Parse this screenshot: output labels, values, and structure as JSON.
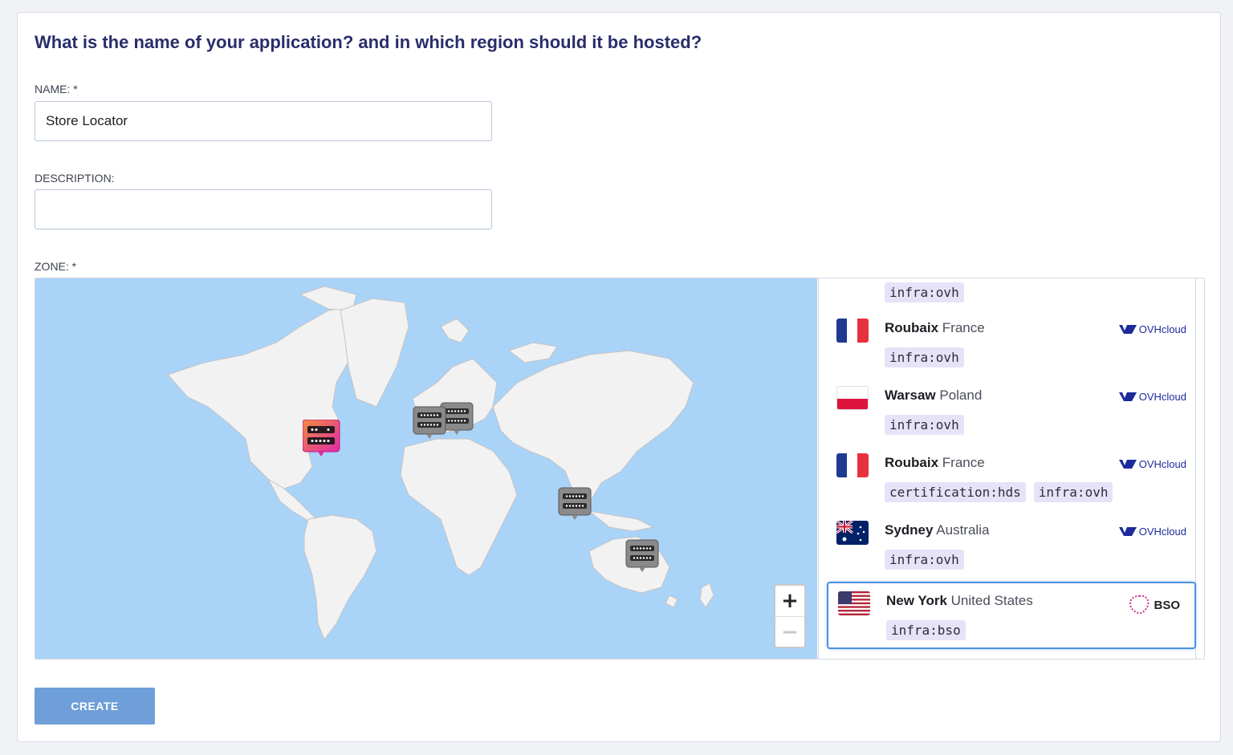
{
  "form": {
    "title": "What is the name of your application? and in which region should it be hosted?",
    "name_label": "NAME: *",
    "name_value": "Store Locator",
    "description_label": "DESCRIPTION:",
    "description_value": "",
    "zone_label": "ZONE: *",
    "create_label": "CREATE"
  },
  "map": {
    "zoom_in": "+",
    "zoom_out": "−",
    "markers": [
      {
        "name": "New York",
        "selected": true
      },
      {
        "name": "Roubaix",
        "selected": false
      },
      {
        "name": "Warsaw",
        "selected": false
      },
      {
        "name": "Singapore",
        "selected": false
      },
      {
        "name": "Sydney",
        "selected": false
      }
    ]
  },
  "zones": {
    "partial_top_tag": "infra:ovh",
    "items": [
      {
        "city": "Roubaix",
        "country": "France",
        "tags": [
          "infra:ovh"
        ],
        "provider": "OVHcloud",
        "flag": "fr-flag-icon"
      },
      {
        "city": "Warsaw",
        "country": "Poland",
        "tags": [
          "infra:ovh"
        ],
        "provider": "OVHcloud",
        "flag": "pl-flag-icon"
      },
      {
        "city": "Roubaix",
        "country": "France",
        "tags": [
          "certification:hds",
          "infra:ovh"
        ],
        "provider": "OVHcloud",
        "flag": "fr-flag-icon"
      },
      {
        "city": "Sydney",
        "country": "Australia",
        "tags": [
          "infra:ovh"
        ],
        "provider": "OVHcloud",
        "flag": "au-flag-icon"
      },
      {
        "city": "New York",
        "country": "United States",
        "tags": [
          "infra:bso"
        ],
        "provider": "BSO",
        "flag": "us-flag-icon",
        "selected": true
      }
    ]
  },
  "colors": {
    "title": "#2a2d6b",
    "ocean": "#aad3f8",
    "land": "#f2f2f2",
    "selected_border": "#4a90e2",
    "button": "#6e9fd8",
    "tag_bg": "#e6e3f8",
    "ovh_blue": "#1b2b9c"
  }
}
